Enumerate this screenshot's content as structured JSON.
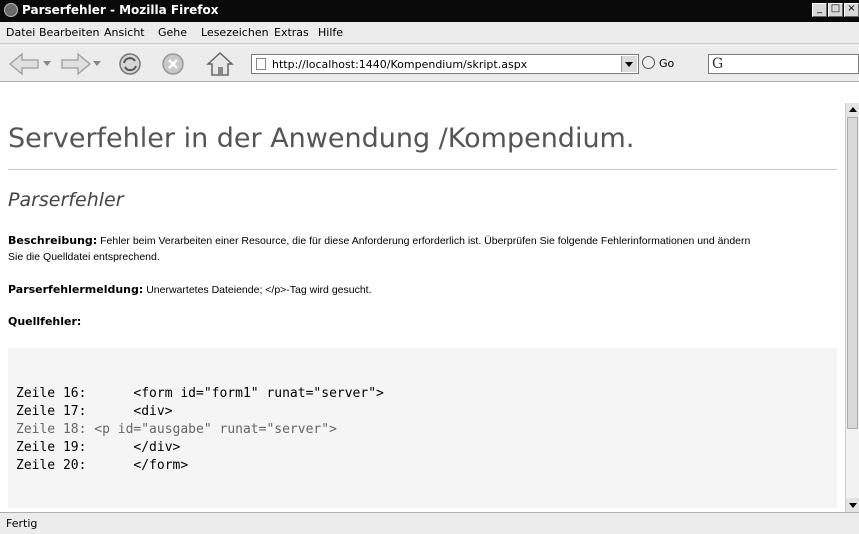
{
  "window": {
    "title": "Parserfehler - Mozilla Firefox"
  },
  "menu": [
    "Datei",
    "Bearbeiten",
    "Ansicht",
    "Gehe",
    "Lesezeichen",
    "Extras",
    "Hilfe"
  ],
  "toolbar": {
    "url": "http://localhost:1440/Kompendium/skript.aspx",
    "go_label": "Go",
    "search_logo": "G"
  },
  "page": {
    "heading": "Serverfehler in der Anwendung /Kompendium.",
    "subheading": "Parserfehler",
    "description_label": "Beschreibung:",
    "description_text": "Fehler beim Verarbeiten einer Resource, die für diese Anforderung erforderlich ist. Überprüfen Sie folgende Fehlerinformationen und ändern Sie die Quelldatei entsprechend.",
    "parser_msg_label": "Parserfehlermeldung:",
    "parser_msg_text": "Unerwartetes Dateiende; </p>-Tag wird gesucht.",
    "source_label": "Quellfehler:",
    "code_lines": [
      "Zeile 16:      <form id=\"form1\" runat=\"server\">",
      "Zeile 17:      <div>",
      "Zeile 18: <p id=\"ausgabe\" runat=\"server\">",
      "Zeile 19:      </div>",
      "Zeile 20:      </form>"
    ]
  },
  "status": {
    "text": "Fertig"
  }
}
